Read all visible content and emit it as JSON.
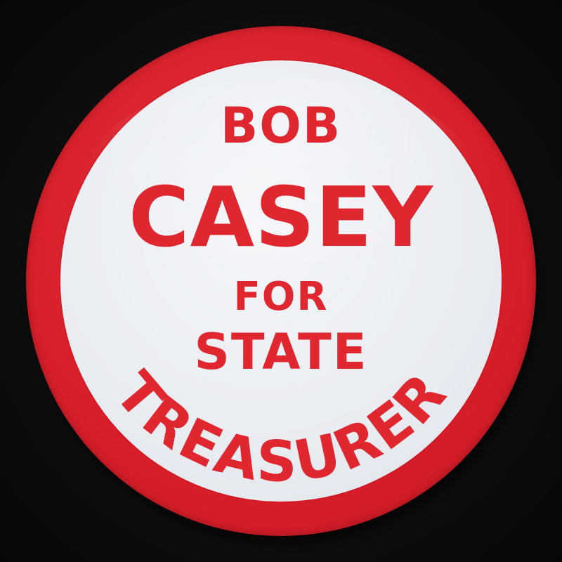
{
  "badge": {
    "line1": "BOB",
    "line2": "CASEY",
    "line3": "FOR",
    "line4": "STATE",
    "arc_text": "TREASURER"
  },
  "colors": {
    "rim": "#d91f2a",
    "face": "#e9ecf1",
    "text": "#e0262f",
    "background": "#0d0d0d"
  }
}
